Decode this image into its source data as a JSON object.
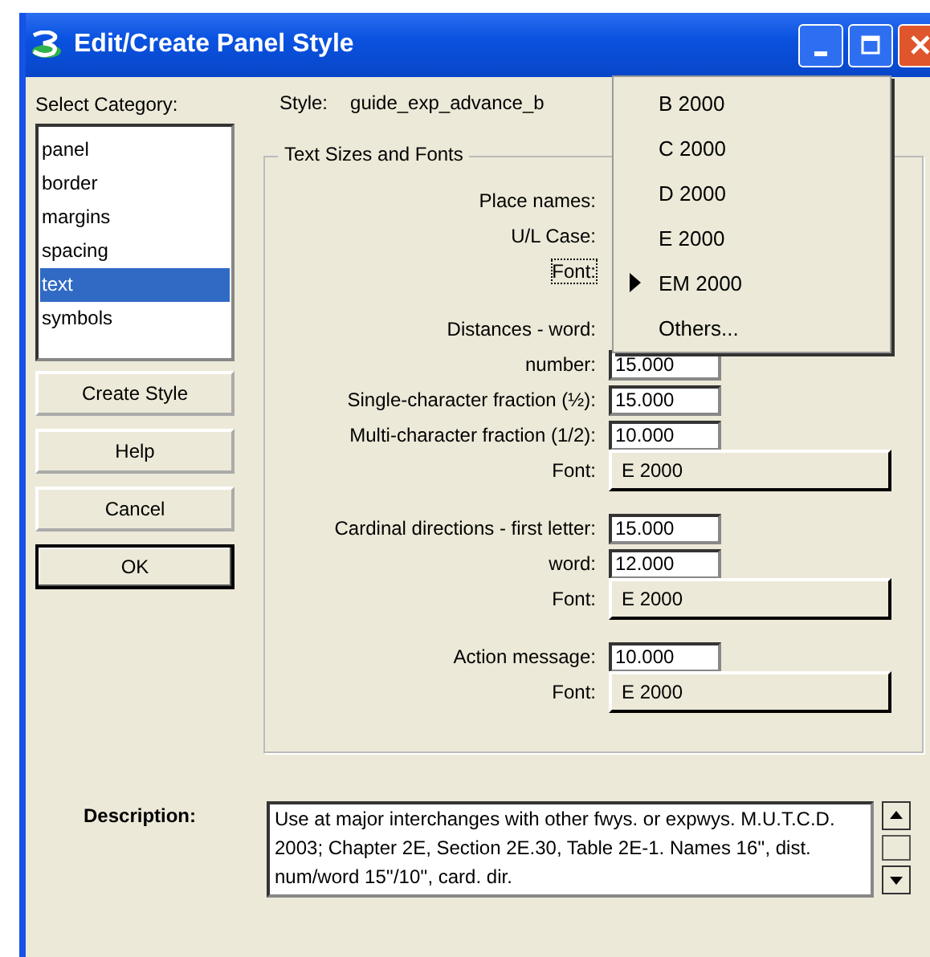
{
  "window": {
    "title": "Edit/Create Panel Style"
  },
  "category": {
    "label": "Select Category:",
    "items": [
      {
        "label": "panel",
        "selected": false
      },
      {
        "label": "border",
        "selected": false
      },
      {
        "label": "margins",
        "selected": false
      },
      {
        "label": "spacing",
        "selected": false
      },
      {
        "label": "text",
        "selected": true
      },
      {
        "label": "symbols",
        "selected": false
      }
    ]
  },
  "buttons": [
    {
      "label": "Create Style",
      "default": false
    },
    {
      "label": "Help",
      "default": false
    },
    {
      "label": "Cancel",
      "default": false
    },
    {
      "label": "OK",
      "default": true
    }
  ],
  "style": {
    "label": "Style:",
    "value": "guide_exp_advance_b"
  },
  "group": {
    "title": "Text Sizes and Fonts",
    "sections": [
      [
        {
          "kind": "label",
          "label": "Place names:",
          "focused": false
        },
        {
          "kind": "label",
          "label": "U/L Case:",
          "focused": false
        },
        {
          "kind": "label",
          "label": "Font:",
          "focused": true
        }
      ],
      [
        {
          "kind": "label",
          "label": "Distances - word:",
          "focused": false
        },
        {
          "kind": "field",
          "label": "number:",
          "value": "15.000"
        },
        {
          "kind": "field",
          "label": "Single-character fraction (½):",
          "value": "15.000"
        },
        {
          "kind": "field",
          "label": "Multi-character fraction (1/2):",
          "value": "10.000"
        },
        {
          "kind": "font",
          "label": "Font:",
          "value": "E 2000"
        }
      ],
      [
        {
          "kind": "field",
          "label": "Cardinal directions - first letter:",
          "value": "15.000"
        },
        {
          "kind": "field",
          "label": "word:",
          "value": "12.000"
        },
        {
          "kind": "font",
          "label": "Font:",
          "value": "E 2000"
        }
      ],
      [
        {
          "kind": "field",
          "label": "Action message:",
          "value": "10.000"
        },
        {
          "kind": "font",
          "label": "Font:",
          "value": "E 2000"
        }
      ]
    ]
  },
  "font_menu": {
    "items": [
      {
        "label": "B 2000",
        "selected": false
      },
      {
        "label": "C 2000",
        "selected": false
      },
      {
        "label": "D 2000",
        "selected": false
      },
      {
        "label": "E 2000",
        "selected": false
      },
      {
        "label": "EM 2000",
        "selected": true
      },
      {
        "label": "Others...",
        "selected": false
      }
    ]
  },
  "description": {
    "label": "Description:",
    "value": "Use at major interchanges with other fwys. or expwys. M.U.T.C.D. 2003; Chapter 2E, Section 2E.30, Table 2E-1. Names 16'', dist. num/word 15''/10'', card. dir."
  }
}
